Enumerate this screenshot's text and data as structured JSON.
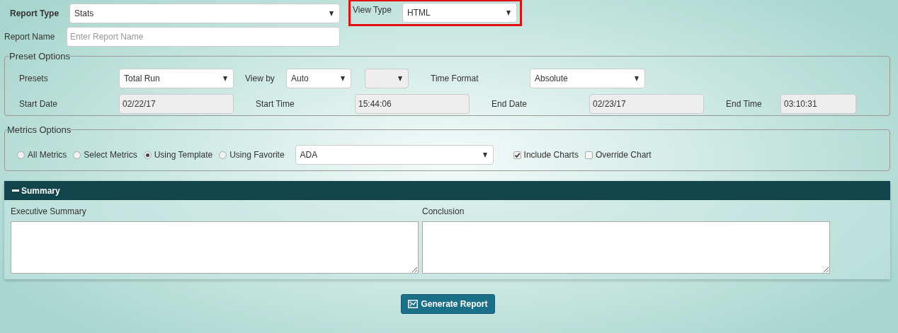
{
  "report_type": {
    "label": "Report Type",
    "value": "Stats"
  },
  "view_type": {
    "label": "View Type",
    "value": "HTML",
    "highlighted": true
  },
  "report_name": {
    "label": "Report Name",
    "placeholder": "Enter Report Name"
  },
  "preset_options": {
    "legend": "Preset Options",
    "presets": {
      "label": "Presets",
      "value": "Total Run"
    },
    "view_by": {
      "label": "View by",
      "value": "Auto"
    },
    "view_by_unit": {
      "disabled": true
    },
    "time_format": {
      "label": "Time Format",
      "value": "Absolute"
    },
    "fields": [
      {
        "label": "Start Date",
        "value": "02/22/17",
        "disabled": true
      },
      {
        "label": "Start Time",
        "value": "15:44:06",
        "disabled": true
      },
      {
        "label": "End Date",
        "value": "02/23/17",
        "disabled": true
      },
      {
        "label": "End Time",
        "value": "03:10:31",
        "disabled": true
      }
    ]
  },
  "metrics_options": {
    "legend": "Metrics Options",
    "radios": [
      {
        "label": "All Metrics",
        "selected": false
      },
      {
        "label": "Select Metrics",
        "selected": false
      },
      {
        "label": "Using Template",
        "selected": true
      },
      {
        "label": "Using Favorite",
        "selected": false
      }
    ],
    "template": {
      "value": "ADA"
    },
    "checkboxes": [
      {
        "label": "Include Charts",
        "checked": true
      },
      {
        "label": "Override Chart",
        "checked": false
      }
    ]
  },
  "summary": {
    "title": "Summary",
    "expanded": true,
    "fields": [
      {
        "label": "Executive Summary"
      },
      {
        "label": "Conclusion"
      }
    ]
  },
  "generate_button": {
    "label": "Generate Report"
  }
}
